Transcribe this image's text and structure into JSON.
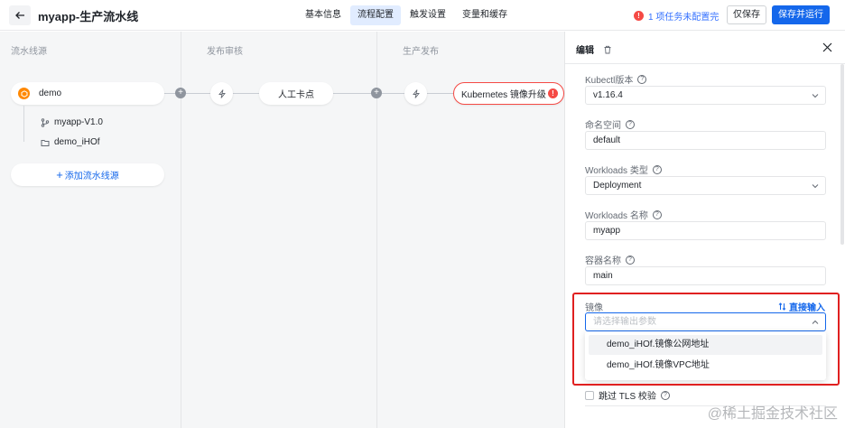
{
  "header": {
    "title": "myapp-生产流水线",
    "tabs": [
      {
        "label": "基本信息",
        "active": false
      },
      {
        "label": "流程配置",
        "active": true
      },
      {
        "label": "触发设置",
        "active": false
      },
      {
        "label": "变量和缓存",
        "active": false
      }
    ],
    "warning": {
      "badge": "!",
      "text": "1 项任务未配置完"
    },
    "save_label": "仅保存",
    "run_label": "保存并运行"
  },
  "canvas": {
    "stages": [
      "流水线源",
      "发布审核",
      "生产发布"
    ],
    "source": {
      "name": "demo",
      "branch": "myapp-V1.0",
      "folder": "demo_iHOf",
      "add_label": "添加流水线源"
    },
    "jobs": [
      {
        "label": "人工卡点",
        "error": false
      },
      {
        "label": "Kubernetes 镜像升级",
        "error": true,
        "badge": "!"
      }
    ],
    "plus_glyph": "+"
  },
  "panel": {
    "title": "编辑",
    "fields": [
      {
        "label": "Kubectl版本",
        "value": "v1.16.4",
        "type": "select"
      },
      {
        "label": "命名空间",
        "value": "default",
        "type": "input"
      },
      {
        "label": "Workloads 类型",
        "value": "Deployment",
        "type": "select"
      },
      {
        "label": "Workloads 名称",
        "value": "myapp",
        "type": "input"
      },
      {
        "label": "容器名称",
        "value": "main",
        "type": "input"
      }
    ],
    "image": {
      "label": "镜像",
      "direct_input": "直接输入",
      "placeholder": "请选择输出参数",
      "options": [
        "demo_iHOf.镜像公网地址",
        "demo_iHOf.镜像VPC地址"
      ]
    },
    "tls": {
      "label": "跳过 TLS 校验",
      "checked": false
    },
    "help_glyph": "?"
  },
  "watermark": "@稀土掘金技术社区",
  "colors": {
    "accent": "#1467eb",
    "error": "#f54a45",
    "source_icon": "#ff8800",
    "highlight": "#e02020"
  }
}
